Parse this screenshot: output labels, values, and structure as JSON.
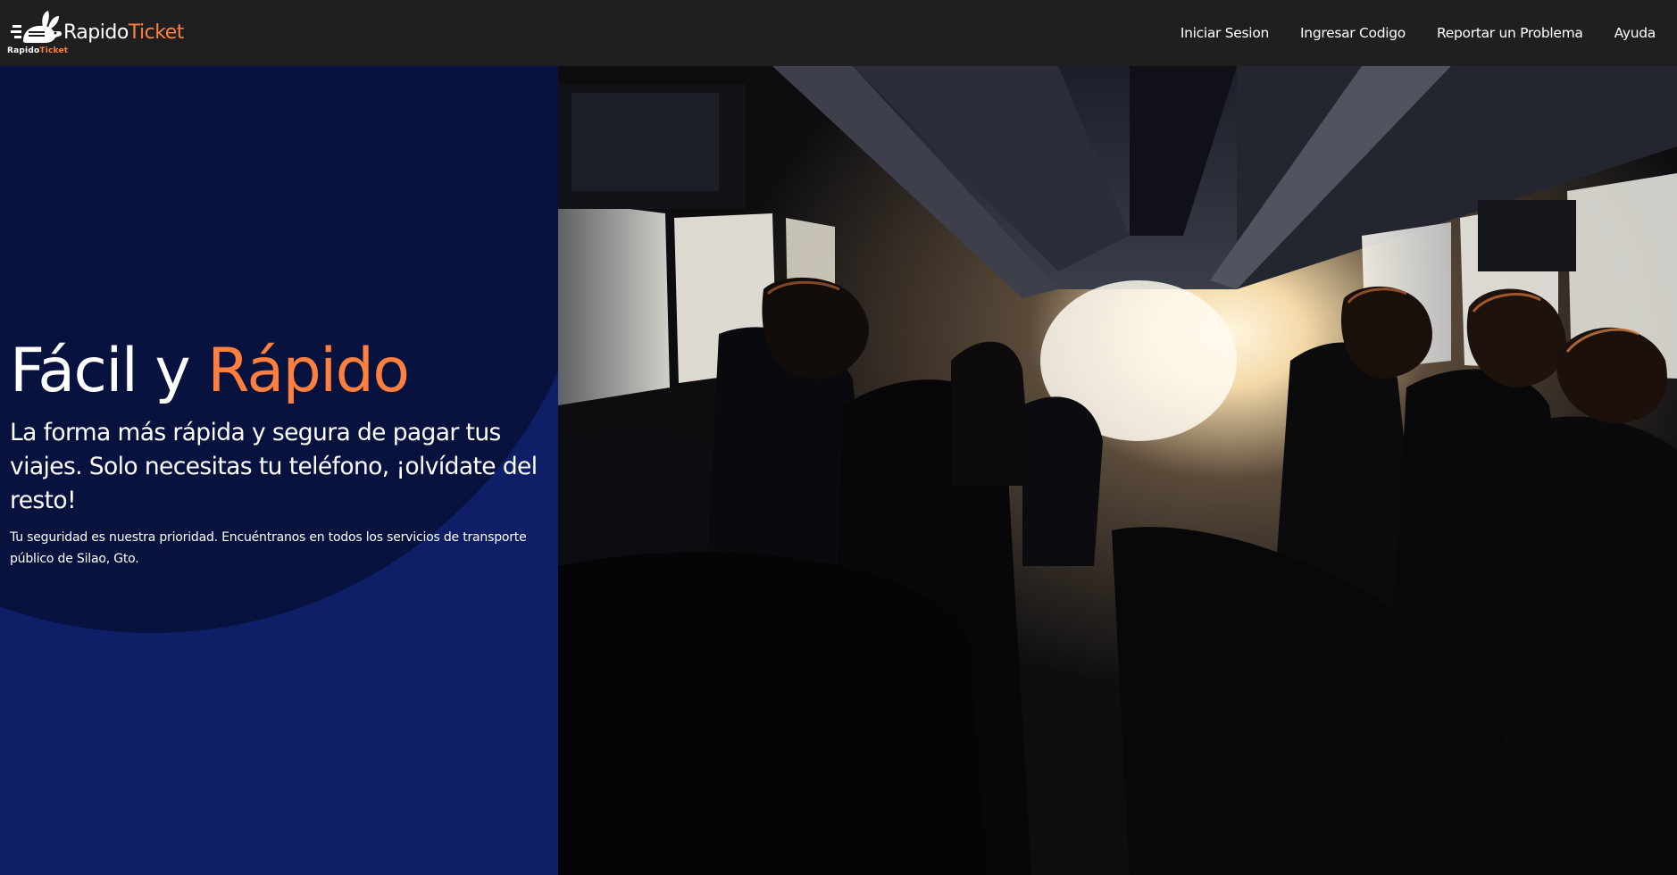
{
  "brand": {
    "name_part1": "Rapido",
    "name_part2": "Ticket",
    "logo_small_part1": "Rapido",
    "logo_small_part2": "Ticket",
    "logo_icon": "rabbit-ticket-icon",
    "accent_color": "#ff7f3f"
  },
  "nav": {
    "items": [
      {
        "label": "Iniciar Sesion"
      },
      {
        "label": "Ingresar Codigo"
      },
      {
        "label": "Reportar un Problema"
      },
      {
        "label": "Ayuda"
      }
    ]
  },
  "hero": {
    "title_part1": "Fácil y",
    "title_part2": "Rápido",
    "subtitle": "La forma más rápida y segura de pagar tus viajes. Solo necesitas tu teléfono, ¡olvídate del resto!",
    "description": "Tu seguridad es nuestra prioridad. Encuéntranos en todos los servicios de transporte público de Silao, Gto.",
    "panel_color": "#0e1f68",
    "circle_color": "#08123f"
  },
  "photo": {
    "subject": "bus-interior-passengers-image"
  }
}
